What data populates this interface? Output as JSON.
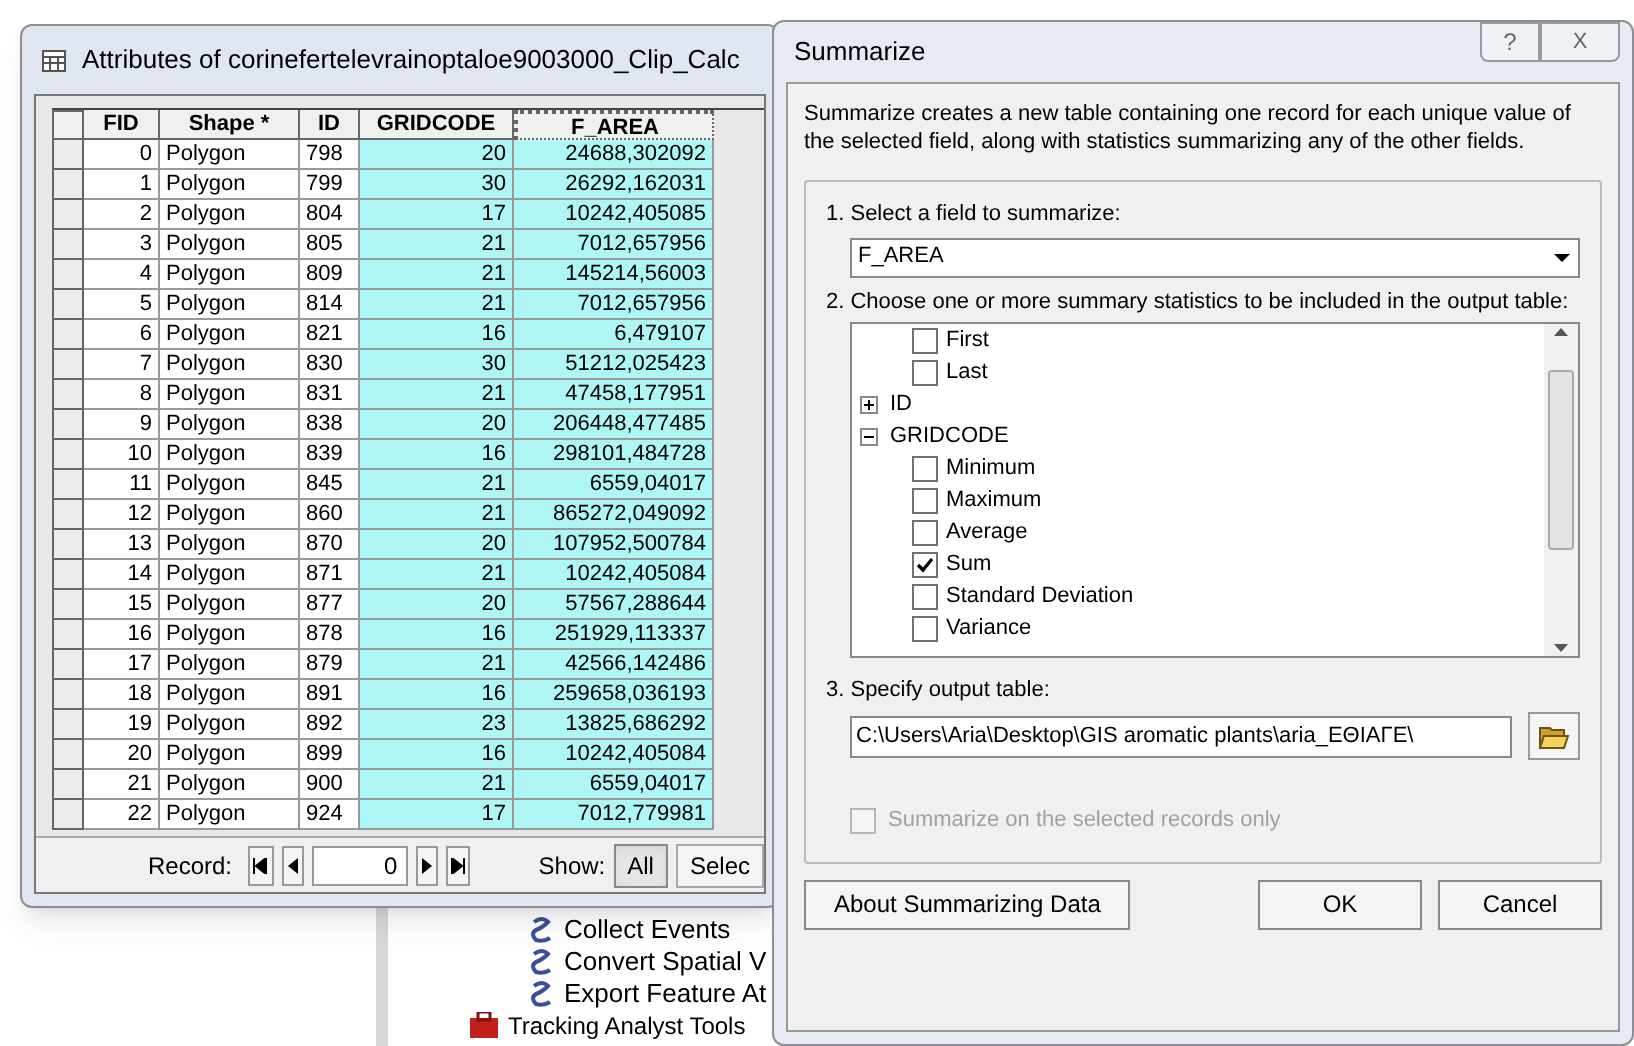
{
  "table_window": {
    "title": "Attributes of corinefertelevrainoptaloe9003000_Clip_Calc",
    "columns": [
      "FID",
      "Shape *",
      "ID",
      "GRIDCODE",
      "F_AREA"
    ],
    "rows": [
      [
        "0",
        "Polygon",
        "798",
        "20",
        "24688,302092"
      ],
      [
        "1",
        "Polygon",
        "799",
        "30",
        "26292,162031"
      ],
      [
        "2",
        "Polygon",
        "804",
        "17",
        "10242,405085"
      ],
      [
        "3",
        "Polygon",
        "805",
        "21",
        "7012,657956"
      ],
      [
        "4",
        "Polygon",
        "809",
        "21",
        "145214,56003"
      ],
      [
        "5",
        "Polygon",
        "814",
        "21",
        "7012,657956"
      ],
      [
        "6",
        "Polygon",
        "821",
        "16",
        "6,479107"
      ],
      [
        "7",
        "Polygon",
        "830",
        "30",
        "51212,025423"
      ],
      [
        "8",
        "Polygon",
        "831",
        "21",
        "47458,177951"
      ],
      [
        "9",
        "Polygon",
        "838",
        "20",
        "206448,477485"
      ],
      [
        "10",
        "Polygon",
        "839",
        "16",
        "298101,484728"
      ],
      [
        "11",
        "Polygon",
        "845",
        "21",
        "6559,04017"
      ],
      [
        "12",
        "Polygon",
        "860",
        "21",
        "865272,049092"
      ],
      [
        "13",
        "Polygon",
        "870",
        "20",
        "107952,500784"
      ],
      [
        "14",
        "Polygon",
        "871",
        "21",
        "10242,405084"
      ],
      [
        "15",
        "Polygon",
        "877",
        "20",
        "57567,288644"
      ],
      [
        "16",
        "Polygon",
        "878",
        "16",
        "251929,113337"
      ],
      [
        "17",
        "Polygon",
        "879",
        "21",
        "42566,142486"
      ],
      [
        "18",
        "Polygon",
        "891",
        "16",
        "259658,036193"
      ],
      [
        "19",
        "Polygon",
        "892",
        "23",
        "13825,686292"
      ],
      [
        "20",
        "Polygon",
        "899",
        "16",
        "10242,405084"
      ],
      [
        "21",
        "Polygon",
        "900",
        "21",
        "6559,04017"
      ],
      [
        "22",
        "Polygon",
        "924",
        "17",
        "7012,779981"
      ]
    ],
    "record_label": "Record:",
    "record_value": "0",
    "show_label": "Show:",
    "show_buttons": [
      {
        "label": "All",
        "selected": true
      },
      {
        "label": "Selec",
        "selected": false
      }
    ]
  },
  "tree": [
    {
      "label": "Collect Events",
      "kind": "tool"
    },
    {
      "label": "Convert Spatial V",
      "kind": "tool"
    },
    {
      "label": "Export Feature At",
      "kind": "tool"
    },
    {
      "label": "Tracking Analyst Tools",
      "kind": "toolbox"
    }
  ],
  "dialog": {
    "title": "Summarize",
    "help": "?",
    "close": "X",
    "description": "Summarize creates a new table containing one record for each unique value of the selected field, along with statistics summarizing any of the other fields.",
    "step1": {
      "label": "1.  Select a field to summarize:",
      "value": "F_AREA"
    },
    "step2": {
      "label": "2.  Choose one or more summary statistics to be included in the output table:",
      "items": [
        {
          "label": "First",
          "kind": "stat",
          "checked": false
        },
        {
          "label": "Last",
          "kind": "stat",
          "checked": false
        },
        {
          "label": "ID",
          "kind": "field",
          "expanded": false
        },
        {
          "label": "GRIDCODE",
          "kind": "field",
          "expanded": true
        },
        {
          "label": "Minimum",
          "kind": "stat",
          "checked": false
        },
        {
          "label": "Maximum",
          "kind": "stat",
          "checked": false
        },
        {
          "label": "Average",
          "kind": "stat",
          "checked": false
        },
        {
          "label": "Sum",
          "kind": "stat",
          "checked": true
        },
        {
          "label": "Standard Deviation",
          "kind": "stat",
          "checked": false
        },
        {
          "label": "Variance",
          "kind": "stat",
          "checked": false
        }
      ]
    },
    "step3": {
      "label": "3.  Specify output table:",
      "value": "C:\\Users\\Aria\\Desktop\\GIS aromatic plants\\aria_ΕΘΙΑΓΕ\\"
    },
    "selected_only": {
      "label": "Summarize on the selected records only",
      "checked": false,
      "disabled": true
    },
    "buttons": [
      "About Summarizing Data",
      "OK",
      "Cancel"
    ]
  }
}
